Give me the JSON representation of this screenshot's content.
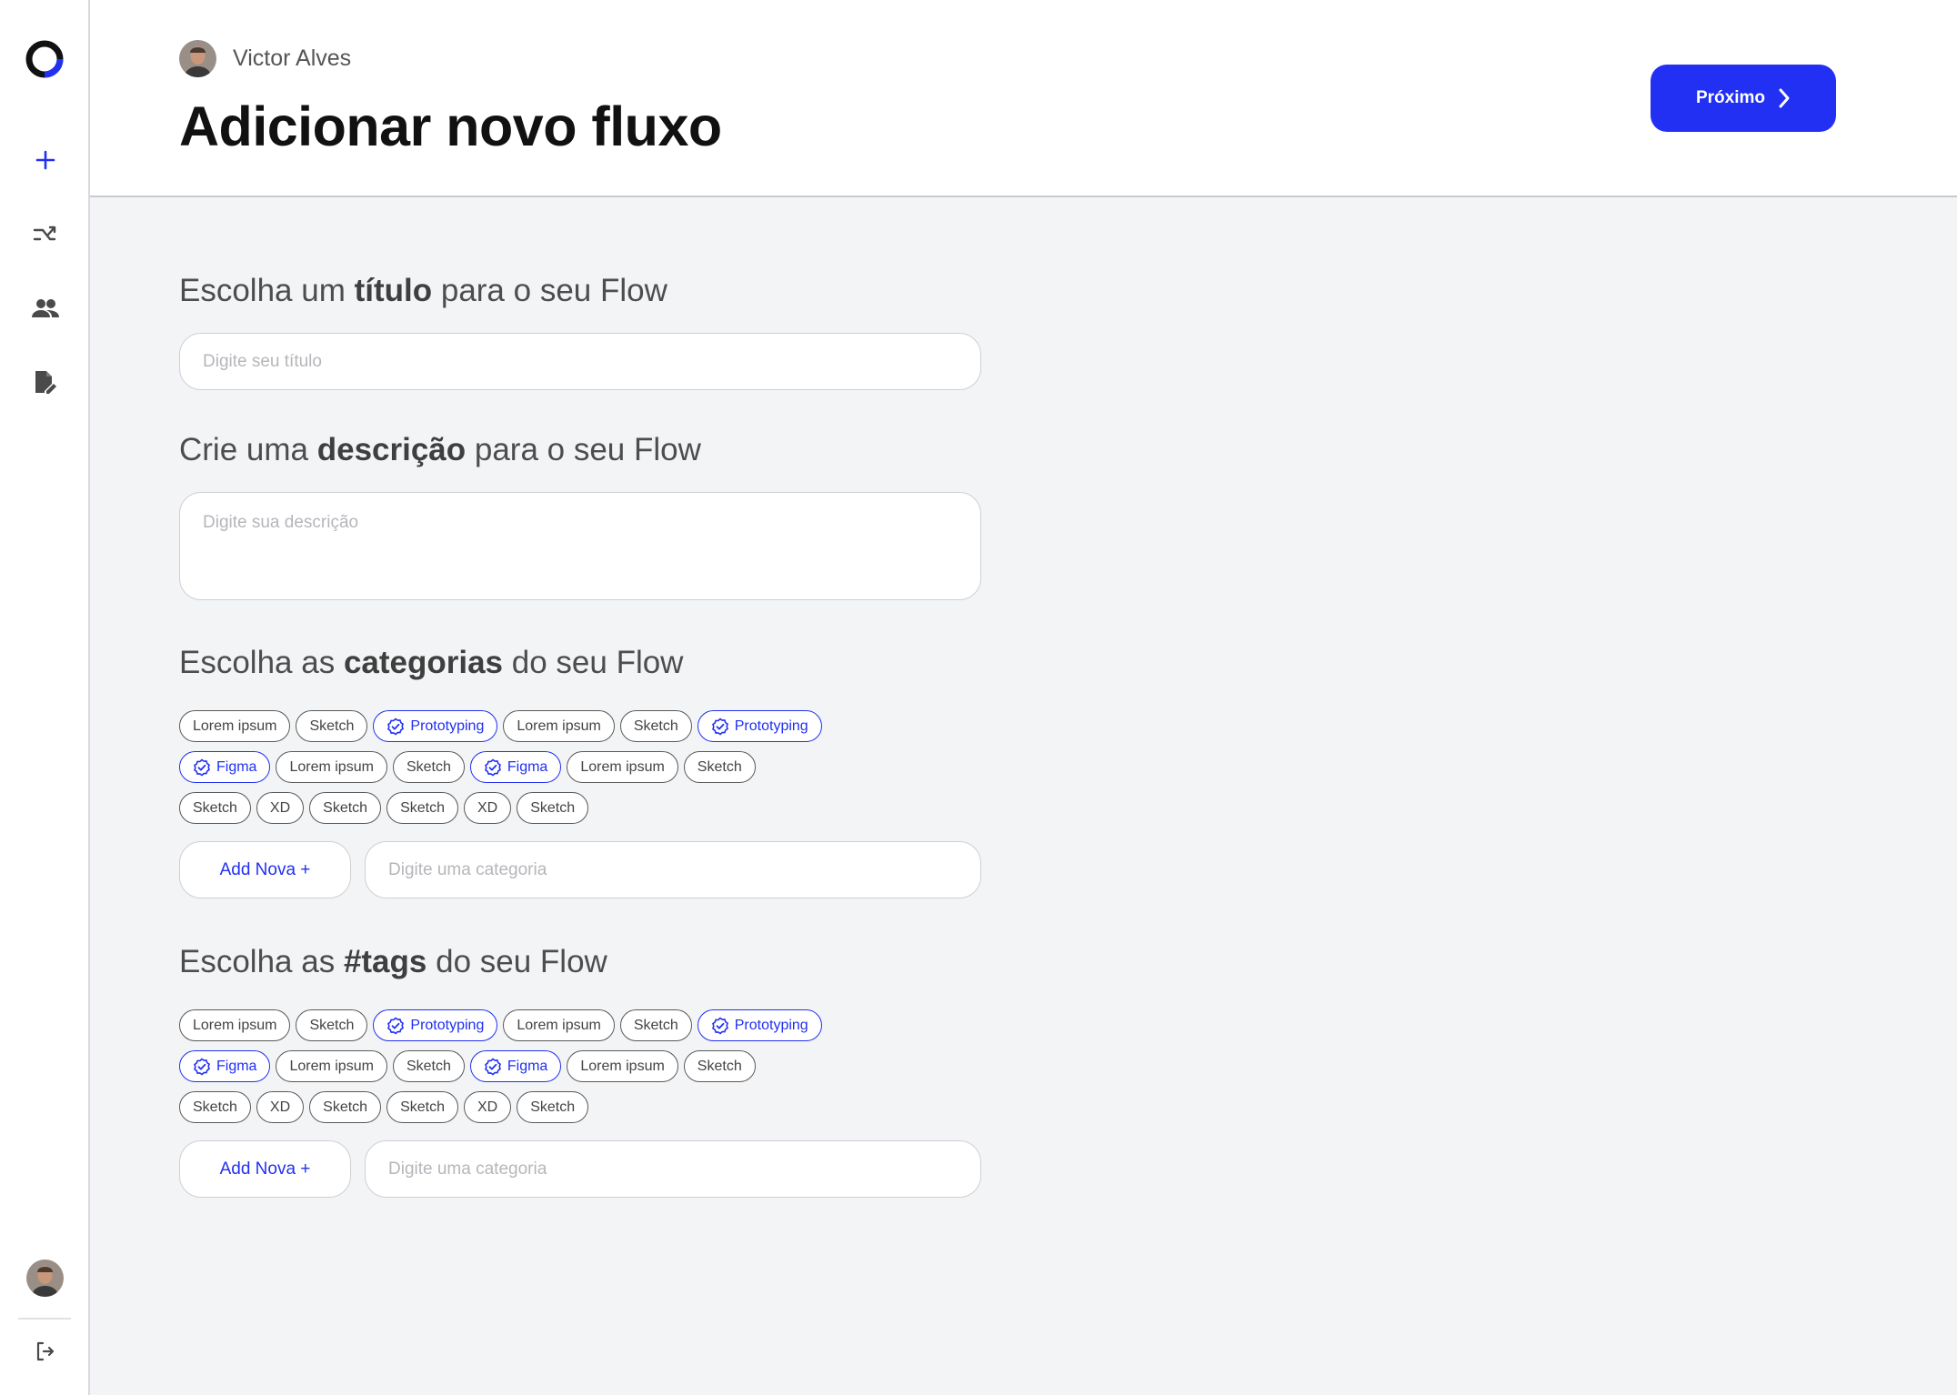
{
  "sidebar": {
    "icons": [
      "logo-icon",
      "plus-icon",
      "flow-icon",
      "people-icon",
      "edit-document-icon",
      "avatar",
      "logout-icon"
    ]
  },
  "header": {
    "user_name": "Victor Alves",
    "title": "Adicionar novo fluxo",
    "next_label": "Próximo"
  },
  "form": {
    "title_section": {
      "pre": "Escolha um ",
      "bold": "título",
      "post": " para o seu Flow",
      "placeholder": "Digite seu título"
    },
    "description_section": {
      "pre": "Crie uma ",
      "bold": "descrição",
      "post": " para o seu Flow",
      "placeholder": "Digite sua descrição"
    },
    "categories_section": {
      "pre": "Escolha as ",
      "bold": "categorias",
      "post": " do seu Flow",
      "rows": [
        [
          {
            "label": "Lorem ipsum",
            "selected": false
          },
          {
            "label": "Sketch",
            "selected": false
          },
          {
            "label": "Prototyping",
            "selected": true
          },
          {
            "label": "Lorem ipsum",
            "selected": false
          },
          {
            "label": "Sketch",
            "selected": false
          },
          {
            "label": "Prototyping",
            "selected": true
          }
        ],
        [
          {
            "label": "Figma",
            "selected": true
          },
          {
            "label": "Lorem ipsum",
            "selected": false
          },
          {
            "label": "Sketch",
            "selected": false
          },
          {
            "label": "Figma",
            "selected": true
          },
          {
            "label": "Lorem ipsum",
            "selected": false
          },
          {
            "label": "Sketch",
            "selected": false
          }
        ],
        [
          {
            "label": "Sketch",
            "selected": false
          },
          {
            "label": "XD",
            "selected": false
          },
          {
            "label": "Sketch",
            "selected": false
          },
          {
            "label": "Sketch",
            "selected": false
          },
          {
            "label": "XD",
            "selected": false
          },
          {
            "label": "Sketch",
            "selected": false
          }
        ]
      ],
      "add_label": "Add Nova +",
      "input_placeholder": "Digite uma categoria"
    },
    "tags_section": {
      "pre": "Escolha as ",
      "bold": "#tags",
      "post": " do seu Flow",
      "rows": [
        [
          {
            "label": "Lorem ipsum",
            "selected": false
          },
          {
            "label": "Sketch",
            "selected": false
          },
          {
            "label": "Prototyping",
            "selected": true
          },
          {
            "label": "Lorem ipsum",
            "selected": false
          },
          {
            "label": "Sketch",
            "selected": false
          },
          {
            "label": "Prototyping",
            "selected": true
          }
        ],
        [
          {
            "label": "Figma",
            "selected": true
          },
          {
            "label": "Lorem ipsum",
            "selected": false
          },
          {
            "label": "Sketch",
            "selected": false
          },
          {
            "label": "Figma",
            "selected": true
          },
          {
            "label": "Lorem ipsum",
            "selected": false
          },
          {
            "label": "Sketch",
            "selected": false
          }
        ],
        [
          {
            "label": "Sketch",
            "selected": false
          },
          {
            "label": "XD",
            "selected": false
          },
          {
            "label": "Sketch",
            "selected": false
          },
          {
            "label": "Sketch",
            "selected": false
          },
          {
            "label": "XD",
            "selected": false
          },
          {
            "label": "Sketch",
            "selected": false
          }
        ]
      ],
      "add_label": "Add Nova +",
      "input_placeholder": "Digite uma categoria"
    }
  },
  "colors": {
    "accent": "#2130f2",
    "background": "#f3f4f6"
  }
}
